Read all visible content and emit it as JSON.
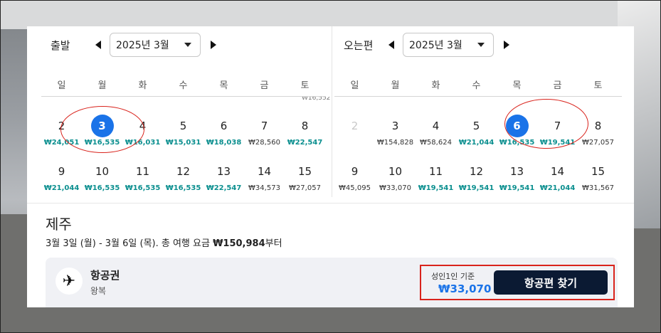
{
  "departure": {
    "title": "출발",
    "month": "2025년 3월",
    "weekdays": [
      "일",
      "월",
      "화",
      "수",
      "목",
      "금",
      "토"
    ],
    "top_stub": "₩16,552",
    "weeks": [
      [
        {
          "day": "2",
          "price": "₩24,051",
          "low": true
        },
        {
          "day": "3",
          "price": "₩16,535",
          "low": true,
          "selected": true
        },
        {
          "day": "4",
          "price": "₩16,031",
          "low": true
        },
        {
          "day": "5",
          "price": "₩15,031",
          "low": true
        },
        {
          "day": "6",
          "price": "₩18,038",
          "low": true
        },
        {
          "day": "7",
          "price": "₩28,560",
          "low": false
        },
        {
          "day": "8",
          "price": "₩22,547",
          "low": true
        }
      ],
      [
        {
          "day": "9",
          "price": "₩21,044",
          "low": true
        },
        {
          "day": "10",
          "price": "₩16,535",
          "low": true
        },
        {
          "day": "11",
          "price": "₩16,535",
          "low": true
        },
        {
          "day": "12",
          "price": "₩16,535",
          "low": true
        },
        {
          "day": "13",
          "price": "₩22,547",
          "low": true
        },
        {
          "day": "14",
          "price": "₩34,573",
          "low": false
        },
        {
          "day": "15",
          "price": "₩27,057",
          "low": false
        }
      ]
    ]
  },
  "return": {
    "title": "오는편",
    "month": "2025년 3월",
    "weekdays": [
      "일",
      "월",
      "화",
      "수",
      "목",
      "금",
      "토"
    ],
    "weeks": [
      [
        {
          "day": "2",
          "price": "",
          "low": false,
          "disabled": true
        },
        {
          "day": "3",
          "price": "₩154,828",
          "low": false
        },
        {
          "day": "4",
          "price": "₩58,624",
          "low": false
        },
        {
          "day": "5",
          "price": "₩21,044",
          "low": true
        },
        {
          "day": "6",
          "price": "₩16,535",
          "low": true,
          "selected": true
        },
        {
          "day": "7",
          "price": "₩19,541",
          "low": true
        },
        {
          "day": "8",
          "price": "₩27,057",
          "low": false
        }
      ],
      [
        {
          "day": "9",
          "price": "₩45,095",
          "low": false
        },
        {
          "day": "10",
          "price": "₩33,070",
          "low": false
        },
        {
          "day": "11",
          "price": "₩19,541",
          "low": true
        },
        {
          "day": "12",
          "price": "₩19,541",
          "low": true
        },
        {
          "day": "13",
          "price": "₩19,541",
          "low": true
        },
        {
          "day": "14",
          "price": "₩21,044",
          "low": true
        },
        {
          "day": "15",
          "price": "₩31,567",
          "low": false
        }
      ]
    ]
  },
  "destination": "제주",
  "summary": {
    "dates": "3월 3일 (월) - 3월 6일 (목). 총 여행 요금 ",
    "total": "₩150,984",
    "suffix": "부터"
  },
  "flight_card": {
    "icon": "airplane-icon",
    "title": "항공권",
    "subtitle": "왕복",
    "price_label": "성인1인 기준",
    "price": "₩33,070",
    "button_label": "항공편 찾기"
  },
  "colors": {
    "selected": "#1a73e8",
    "low_price": "#0b8f8f",
    "highlight": "#d9231c",
    "button": "#0b1a33"
  }
}
